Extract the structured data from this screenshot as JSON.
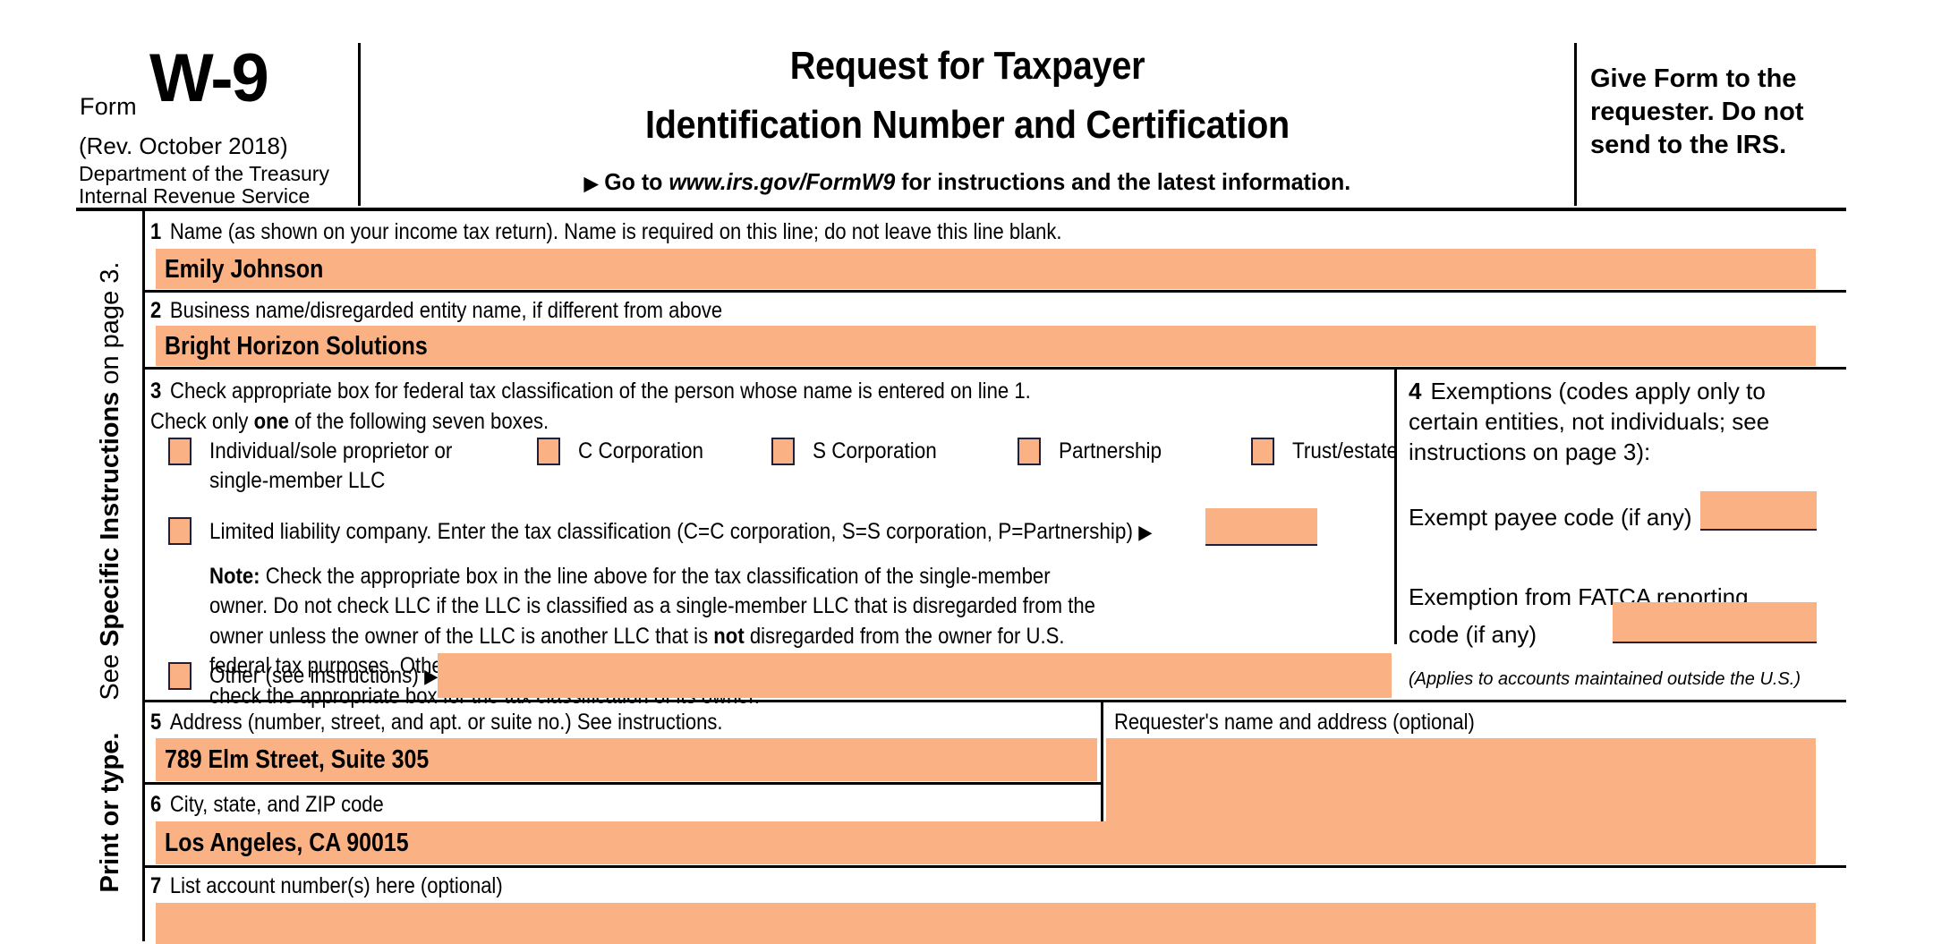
{
  "document": {
    "type": "IRS Form W-9",
    "form_word": "Form",
    "form_number": "W-9",
    "revision": "(Rev. October 2018)",
    "dept_line1": "Department of the Treasury",
    "dept_line2": "Internal Revenue Service",
    "title_line1": "Request for Taxpayer",
    "title_line2": "Identification Number and Certification",
    "goto_arrow": "▶",
    "goto_prefix": "Go to",
    "goto_url": "www.irs.gov/FormW9",
    "goto_suffix": "for instructions and the latest information.",
    "give_form_note": "Give Form to the requester. Do not send to the IRS."
  },
  "sidebar": {
    "line1": "Print or type.",
    "line2_prefix": "See ",
    "line2_bold": "Specific Instructions",
    "line2_suffix": " on page 3."
  },
  "line1": {
    "number": "1",
    "label": "Name (as shown on your income tax return). Name is required on this line; do not leave this line blank.",
    "value": "Emily Johnson"
  },
  "line2": {
    "number": "2",
    "label": "Business name/disregarded entity name, if different from above",
    "value": "Bright Horizon Solutions"
  },
  "line3": {
    "number": "3",
    "instruction_a": "Check appropriate box for federal tax classification of the person whose name is entered on line 1. Check only ",
    "instruction_bold": "one",
    "instruction_b": " of the following seven boxes.",
    "checkboxes": [
      {
        "id": "individual",
        "label_line1": "Individual/sole proprietor or",
        "label_line2": "single-member LLC",
        "checked": false
      },
      {
        "id": "c-corporation",
        "label_line1": "C Corporation",
        "label_line2": "",
        "checked": false
      },
      {
        "id": "s-corporation",
        "label_line1": "S Corporation",
        "label_line2": "",
        "checked": false
      },
      {
        "id": "partnership",
        "label_line1": "Partnership",
        "label_line2": "",
        "checked": false
      },
      {
        "id": "trust-estate",
        "label_line1": "Trust/estate",
        "label_line2": "",
        "checked": false
      }
    ],
    "llc": {
      "label": "Limited liability company. Enter the tax classification (C=C corporation, S=S corporation, P=Partnership)",
      "arrow": "▶",
      "value": "",
      "checked": false
    },
    "note_label": "Note:",
    "note_text": " Check the appropriate box in the line above for the tax classification of the single-member owner.  Do not check LLC if the LLC is classified as a single-member LLC that is disregarded from the owner unless the owner of the LLC is another LLC that is ",
    "note_bold": "not",
    "note_text2": " disregarded from the owner for U.S. federal tax purposes. Otherwise, a single-member LLC that is disregarded from the owner should check the appropriate box for the tax classification of its owner.",
    "other": {
      "label": "Other (see instructions)",
      "arrow": "▶",
      "value": "",
      "checked": false
    }
  },
  "line4": {
    "number": "4",
    "label_line1": "Exemptions (codes apply only to",
    "label_line2": "certain entities, not individuals; see",
    "label_line3": "instructions on page 3):",
    "exempt_payee_label": "Exempt payee code (if any)",
    "exempt_payee_value": "",
    "fatca_label_line1": "Exemption from FATCA reporting",
    "fatca_label_line2": "code (if any)",
    "fatca_value": "",
    "applies_note": "(Applies to accounts maintained outside the U.S.)"
  },
  "line5": {
    "number": "5",
    "label": "Address (number, street, and apt. or suite no.) See instructions.",
    "value": "789 Elm Street, Suite 305"
  },
  "line6": {
    "number": "6",
    "label": "City, state, and ZIP code",
    "value": "Los Angeles, CA 90015"
  },
  "line7": {
    "number": "7",
    "label": "List account number(s) here (optional)",
    "value": ""
  },
  "requester": {
    "label": "Requester's name and address (optional)",
    "value": ""
  },
  "colors": {
    "field_fill": "#FAB184",
    "rule": "#000000",
    "checkbox_border": "#20203A",
    "page_background": "#FFFFFF"
  }
}
